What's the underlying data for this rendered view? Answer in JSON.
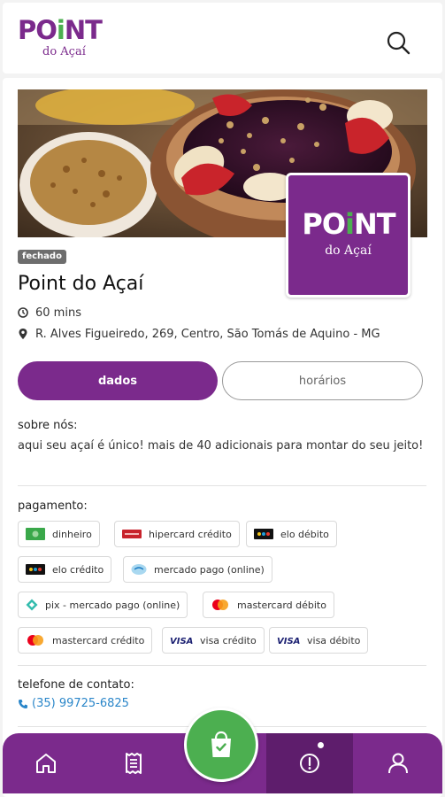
{
  "app": {
    "brand_word": "POiNT",
    "brand_sub": "do Açaí",
    "colors": {
      "brand_purple": "#7b2a8c",
      "brand_green": "#4caf50",
      "link_blue": "#2a86c9"
    }
  },
  "header": {
    "search_icon": "search-icon"
  },
  "store": {
    "status": "fechado",
    "name": "Point do Açaí",
    "logo_word": "POiNT",
    "logo_sub": "do Açaí",
    "delivery_time": "60 mins",
    "address": "R. Alves Figueiredo, 269, Centro, São Tomás de Aquino - MG"
  },
  "tabs": [
    {
      "label": "dados",
      "active": true
    },
    {
      "label": "horários",
      "active": false
    }
  ],
  "about": {
    "label": "sobre nós:",
    "text": "aqui seu açaí é único! mais de 40 adicionais para montar do seu jeito!"
  },
  "payment": {
    "label": "pagamento:",
    "methods": [
      {
        "label": "dinheiro",
        "icon": "cash-icon"
      },
      {
        "label": "hipercard crédito",
        "icon": "hipercard-icon"
      },
      {
        "label": "elo débito",
        "icon": "elo-icon"
      },
      {
        "label": "elo crédito",
        "icon": "elo-icon"
      },
      {
        "label": "mercado pago (online)",
        "icon": "mercadopago-icon"
      },
      {
        "label": "pix - mercado pago (online)",
        "icon": "pix-icon"
      },
      {
        "label": "mastercard débito",
        "icon": "mastercard-icon"
      },
      {
        "label": "mastercard crédito",
        "icon": "mastercard-icon"
      },
      {
        "label": "visa crédito",
        "icon": "visa-icon"
      },
      {
        "label": "visa débito",
        "icon": "visa-icon"
      }
    ]
  },
  "contact": {
    "label": "telefone de contato:",
    "phone": "(35) 99725-6825"
  },
  "bottom_nav": {
    "items": [
      {
        "icon": "home-icon"
      },
      {
        "icon": "receipt-icon"
      },
      {
        "icon": "shopping-bag-icon"
      },
      {
        "icon": "info-icon",
        "active": true
      },
      {
        "icon": "user-icon"
      }
    ]
  }
}
